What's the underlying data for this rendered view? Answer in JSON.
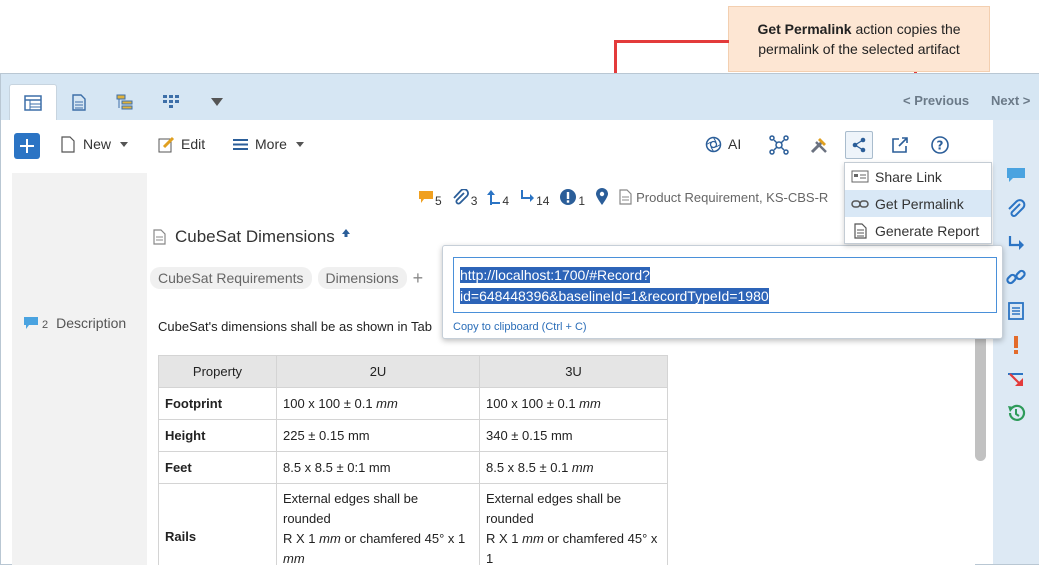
{
  "callout": {
    "bold_text": "Get Permalink",
    "text_1": " action copies the",
    "text_2": "permalink of the selected artifact"
  },
  "tabs": [
    {
      "icon": "list-view-icon",
      "active": true
    },
    {
      "icon": "document-view-icon",
      "active": false
    },
    {
      "icon": "tree-view-icon",
      "active": false
    },
    {
      "icon": "grid-view-icon",
      "active": false
    },
    {
      "icon": "more-views-icon",
      "active": false
    }
  ],
  "nav": {
    "previous": "< Previous",
    "next": "Next >"
  },
  "toolbar": {
    "new_label": "New",
    "edit_label": "Edit",
    "more_label": "More",
    "ai_label": "AI"
  },
  "share_menu": {
    "items": [
      {
        "label": "Share Link",
        "icon": "share-link-icon"
      },
      {
        "label": "Get Permalink",
        "icon": "chain-link-icon"
      },
      {
        "label": "Generate Report",
        "icon": "report-icon"
      }
    ]
  },
  "meta": {
    "comments": "5",
    "attachments": "3",
    "upstream": "4",
    "downstream": "14",
    "suspect": "1",
    "type_label": "Product Requirement, KS-CBS-R"
  },
  "artifact": {
    "title": "CubeSat Dimensions",
    "tags": [
      "CubeSat Requirements",
      "Dimensions"
    ],
    "tag_add": "+",
    "description_label": "Description",
    "description_count": "2",
    "description_text": "CubeSat's dimensions shall be as shown in Tab"
  },
  "permalink": {
    "line_1": "http://localhost:1700/#Record?",
    "line_2": "id=648448396&baselineId=1&recordTypeId=1980",
    "copy_hint": "Copy to clipboard (Ctrl + C)"
  },
  "table": {
    "headers": [
      "Property",
      "2U",
      "3U"
    ],
    "rows": [
      {
        "name": "Footprint",
        "c2_a": "100 x 100 ",
        "c2_pm": "±",
        "c2_b": " 0.1 ",
        "c2_unit": "mm",
        "c3_a": "100 x 100 ",
        "c3_pm": "±",
        "c3_b": " 0.1 ",
        "c3_unit": "mm"
      },
      {
        "name": "Height",
        "c2": "225 ± 0.15 mm",
        "c3": "340 ± 0.15 mm"
      },
      {
        "name": "Feet",
        "c2": "8.5 x 8.5 ± 0:1 mm",
        "c3_a": "8.5 x 8.5 ± 0.1 ",
        "c3_unit": "mm"
      },
      {
        "name": "Rails",
        "line1": "External edges shall be",
        "line2": "rounded",
        "line3_a": "R X 1 ",
        "line3_unit": "mm",
        "line3_b": " or chamfered 45° x 1",
        "line4": "mm"
      }
    ]
  },
  "colors": {
    "accent": "#2b74c4",
    "callout_bg": "#fde6d3",
    "arrow": "#e33b3b",
    "selection": "#2d64b8"
  }
}
